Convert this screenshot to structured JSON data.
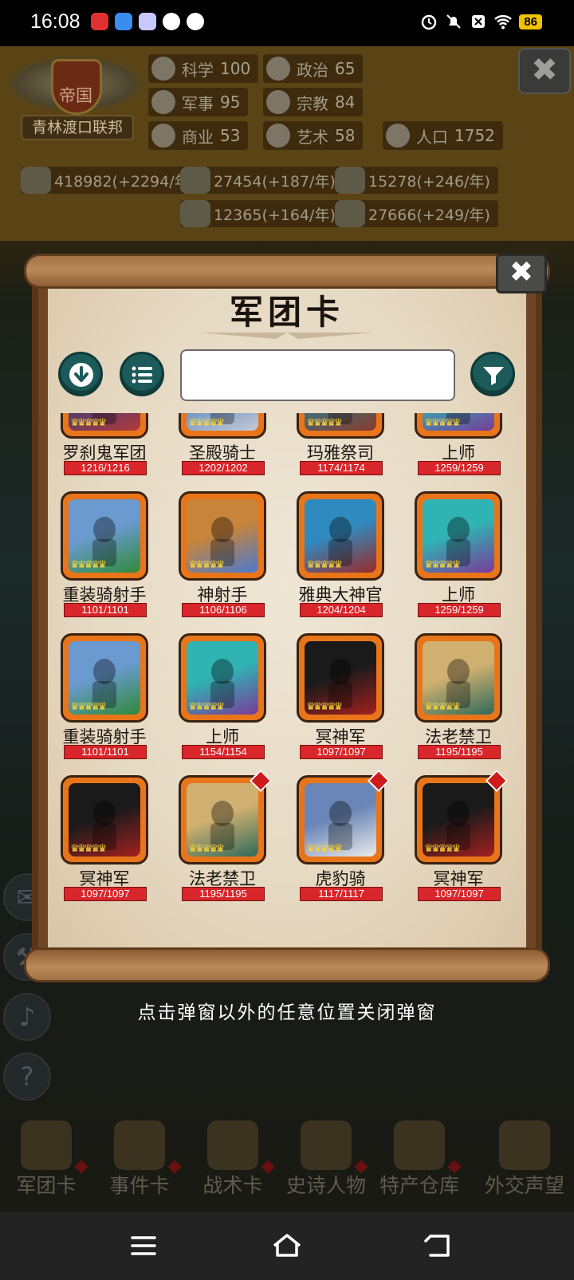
{
  "status_bar": {
    "time": "16:08",
    "battery": "86"
  },
  "empire": {
    "title": "帝国",
    "name": "青林渡口联邦"
  },
  "stats": [
    {
      "label": "科学",
      "value": "100"
    },
    {
      "label": "政治",
      "value": "65"
    },
    {
      "label": "军事",
      "value": "95"
    },
    {
      "label": "宗教",
      "value": "84"
    },
    {
      "label": "商业",
      "value": "53"
    },
    {
      "label": "艺术",
      "value": "58"
    },
    {
      "label": "人口",
      "value": "1752"
    }
  ],
  "resources": [
    {
      "text": "418982(+2294/年)"
    },
    {
      "text": "27454(+187/年)"
    },
    {
      "text": "15278(+246/年)"
    },
    {
      "text": "12365(+164/年)"
    },
    {
      "text": "27666(+249/年)"
    }
  ],
  "modal": {
    "title": "军团卡",
    "search_value": "",
    "close_hint": "点击弹窗以外的任意位置关闭弹窗"
  },
  "cards": [
    {
      "name": "罗刹鬼军团",
      "hp": "1216/1216"
    },
    {
      "name": "圣殿骑士",
      "hp": "1202/1202"
    },
    {
      "name": "玛雅祭司",
      "hp": "1174/1174"
    },
    {
      "name": "上师",
      "hp": "1259/1259"
    },
    {
      "name": "重装骑射手",
      "hp": "1101/1101"
    },
    {
      "name": "神射手",
      "hp": "1106/1106"
    },
    {
      "name": "雅典大神官",
      "hp": "1204/1204"
    },
    {
      "name": "上师",
      "hp": "1259/1259"
    },
    {
      "name": "重装骑射手",
      "hp": "1101/1101"
    },
    {
      "name": "上师",
      "hp": "1154/1154"
    },
    {
      "name": "冥神军",
      "hp": "1097/1097"
    },
    {
      "name": "法老禁卫",
      "hp": "1195/1195"
    },
    {
      "name": "冥神军",
      "hp": "1097/1097"
    },
    {
      "name": "法老禁卫",
      "hp": "1195/1195"
    },
    {
      "name": "虎豹骑",
      "hp": "1117/1117"
    },
    {
      "name": "冥神军",
      "hp": "1097/1097"
    }
  ],
  "bottom_nav": [
    {
      "label": "军团卡"
    },
    {
      "label": "事件卡"
    },
    {
      "label": "战术卡"
    },
    {
      "label": "史诗人物"
    },
    {
      "label": "特产仓库"
    },
    {
      "label": "外交声望"
    }
  ]
}
